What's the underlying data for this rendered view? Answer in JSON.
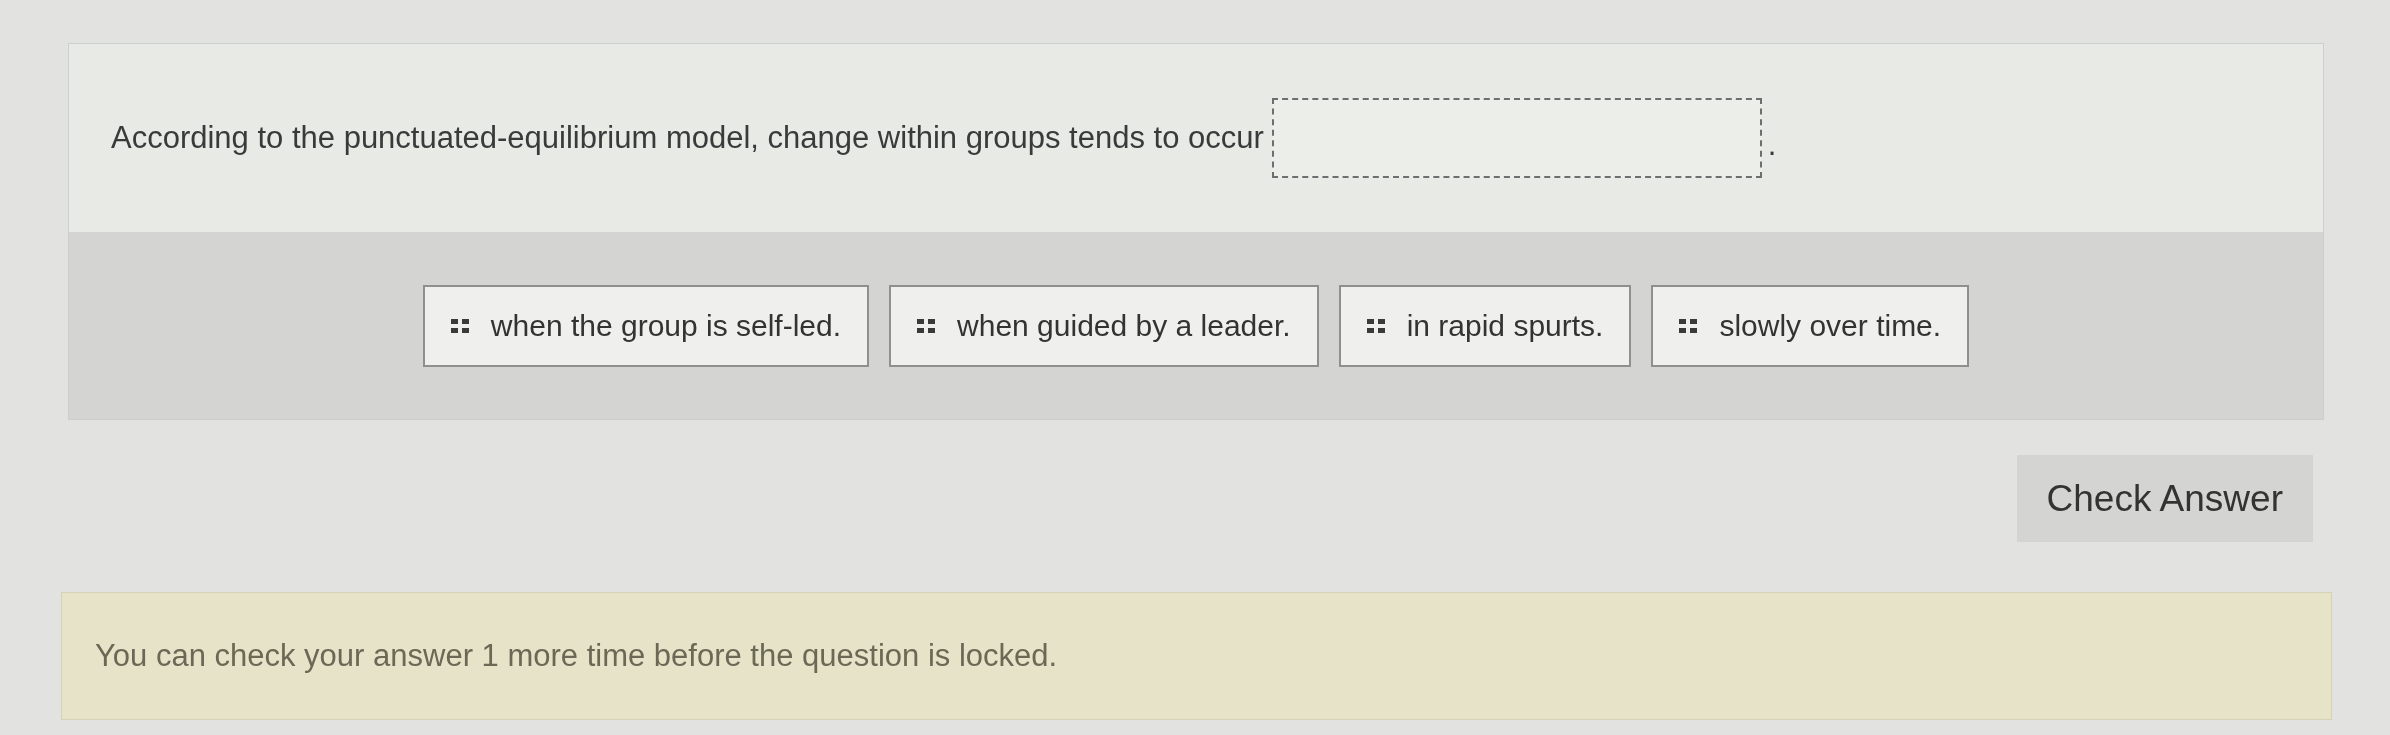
{
  "question": {
    "text_before_blank": "According to the punctuated-equilibrium model, change within groups tends to occur",
    "text_after_blank": "."
  },
  "choices": [
    {
      "label": "when the group is self-led."
    },
    {
      "label": "when guided by a leader."
    },
    {
      "label": "in rapid spurts."
    },
    {
      "label": "slowly over time."
    }
  ],
  "check_button": {
    "label": "Check Answer"
  },
  "attempts_notice": "You can check your answer 1 more time before the question is locked."
}
